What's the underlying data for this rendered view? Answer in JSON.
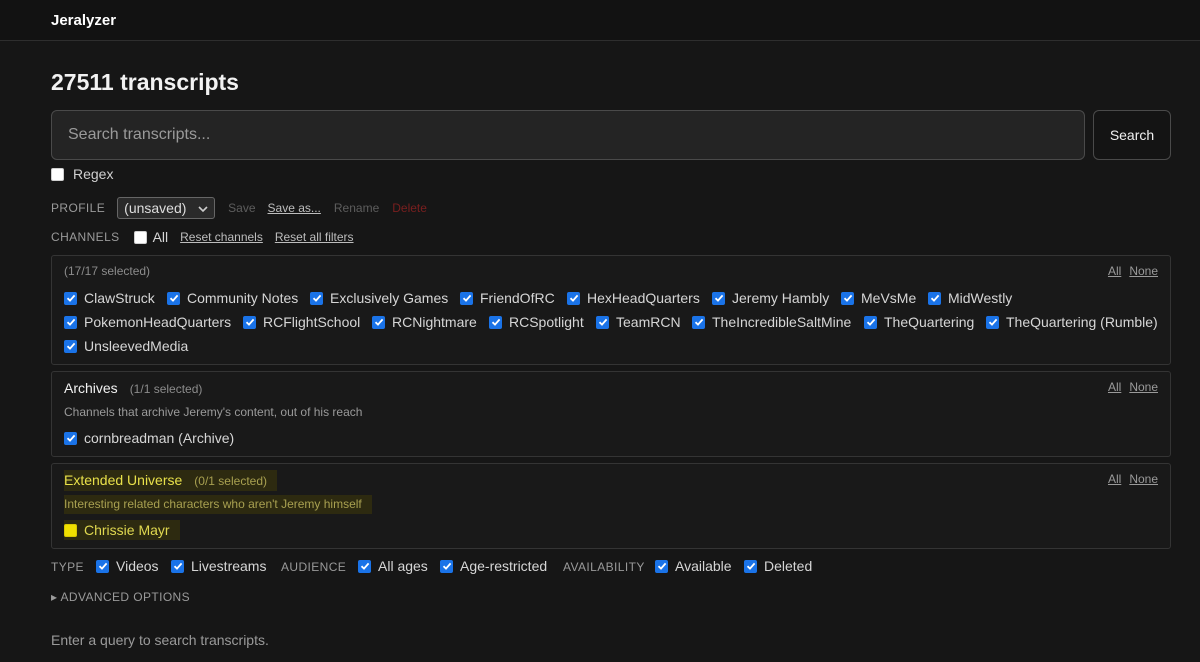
{
  "app": {
    "title": "Jeralyzer"
  },
  "page": {
    "heading": "27511 transcripts"
  },
  "search": {
    "placeholder": "Search transcripts...",
    "value": "",
    "button": "Search",
    "regex_label": "Regex",
    "regex_checked": false
  },
  "profile": {
    "label": "PROFILE",
    "selected": "(unsaved)",
    "save": "Save",
    "save_as": "Save as...",
    "rename": "Rename",
    "delete": "Delete"
  },
  "channels": {
    "label": "CHANNELS",
    "all_label": "All",
    "reset_channels": "Reset channels",
    "reset_all": "Reset all filters"
  },
  "groups": {
    "main": {
      "count": "(17/17 selected)",
      "all": "All",
      "none": "None",
      "items": [
        "ClawStruck",
        "Community Notes",
        "Exclusively Games",
        "FriendOfRC",
        "HexHeadQuarters",
        "Jeremy Hambly",
        "MeVsMe",
        "MidWestly",
        "PokemonHeadQuarters",
        "RCFlightSchool",
        "RCNightmare",
        "RCSpotlight",
        "TeamRCN",
        "TheIncredibleSaltMine",
        "TheQuartering",
        "TheQuartering (Rumble)",
        "UnsleevedMedia"
      ]
    },
    "archives": {
      "title": "Archives",
      "count": "(1/1 selected)",
      "desc": "Channels that archive Jeremy's content, out of his reach",
      "all": "All",
      "none": "None",
      "items": [
        "cornbreadman (Archive)"
      ]
    },
    "extended": {
      "title": "Extended Universe",
      "count": "(0/1 selected)",
      "desc": "Interesting related characters who aren't Jeremy himself",
      "all": "All",
      "none": "None",
      "items": [
        "Chrissie Mayr"
      ]
    }
  },
  "filters": {
    "type_label": "TYPE",
    "videos": "Videos",
    "livestreams": "Livestreams",
    "audience_label": "AUDIENCE",
    "all_ages": "All ages",
    "age_restricted": "Age-restricted",
    "availability_label": "AVAILABILITY",
    "available": "Available",
    "deleted": "Deleted"
  },
  "advanced": "▸ ADVANCED OPTIONS",
  "hint": "Enter a query to search transcripts.",
  "colors": {
    "accent": "#1a73e8",
    "highlight": "#f0e000",
    "danger": "#7a1f1f"
  }
}
